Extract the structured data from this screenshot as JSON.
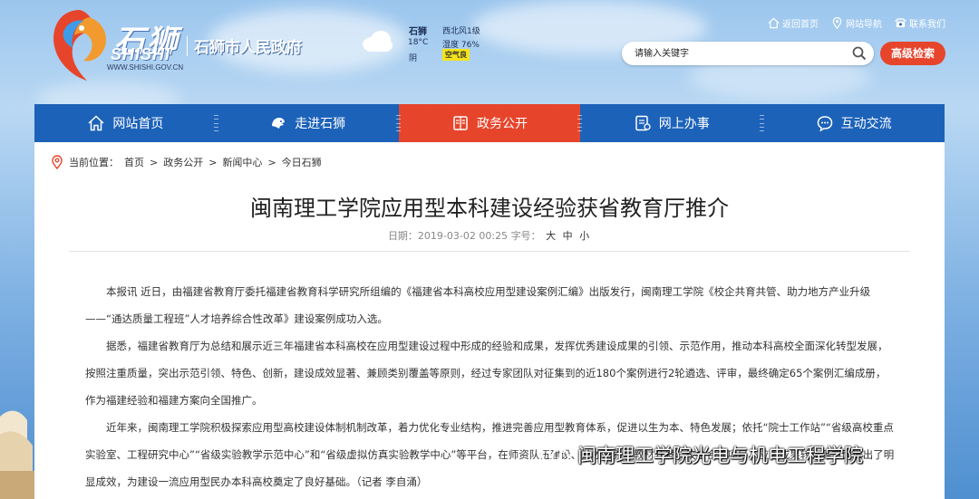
{
  "header": {
    "brand_cn": "石狮",
    "brand_en": "SHISHI",
    "brand_url": "WWW.SHISHI.GOV.CN",
    "gov_name": "石狮市人民政府",
    "weather": {
      "city": "石狮",
      "temperature": "18°C",
      "condition": "阴",
      "wind": "西北风1级",
      "humidity": "湿度 76%",
      "air": "空气良",
      "icon": "cloud-icon"
    },
    "toplinks": [
      {
        "label": "返回首页",
        "icon": "home-icon"
      },
      {
        "label": "网站导航",
        "icon": "location-icon"
      },
      {
        "label": "联系我们",
        "icon": "phone-icon"
      }
    ],
    "search": {
      "placeholder": "请输入关键字"
    },
    "advanced_search": "高级检索"
  },
  "nav": [
    {
      "label": "网站首页",
      "icon": "home-icon",
      "active": false
    },
    {
      "label": "走进石狮",
      "icon": "lion-icon",
      "active": false
    },
    {
      "label": "政务公开",
      "icon": "document-icon",
      "active": true
    },
    {
      "label": "网上办事",
      "icon": "service-icon",
      "active": false
    },
    {
      "label": "互动交流",
      "icon": "chat-icon",
      "active": false
    }
  ],
  "breadcrumb": {
    "prefix": "当前位置：",
    "items": [
      "首页",
      "政务公开",
      "新闻中心",
      "今日石狮"
    ],
    "separator": ">"
  },
  "article": {
    "title": "闽南理工学院应用型本科建设经验获省教育厅推介",
    "date_label": "日期：2019-03-02 00:25",
    "font_label": "字号：",
    "font_sizes": [
      "大",
      "中",
      "小"
    ],
    "paragraphs": [
      "本报讯 近日，由福建省教育厅委托福建省教育科学研究所组编的《福建省本科高校应用型建设案例汇编》出版发行，闽南理工学院《校企共育共管、助力地方产业升级——“通达质量工程班”人才培养综合性改革》建设案例成功入选。",
      "据悉，福建省教育厅为总结和展示近三年福建省本科高校在应用型建设过程中形成的经验和成果，发挥优秀建设成果的引领、示范作用，推动本科高校全面深化转型发展，按照注重质量，突出示范引领、特色、创新，建设成效显著、兼顾类别覆盖等原则，经过专家团队对征集到的近180个案例进行2轮遴选、评审，最终确定65个案例汇编成册，作为福建经验和福建方案向全国推广。",
      "近年来，闽南理工学院积极探索应用型高校建设体制机制改革，着力优化专业结构，推进完善应用型教育体系，促进以生为本、特色发展；依托“院士工作站”“省级高校重点实验室、工程研究中心”“省级实验教学示范中心”和“省级虚拟仿真实验教学中心”等平台，在师资队伍建设、人才培养、教材开发、校企合作项目、应用成果转化等方面做出了明显成效，为建设一流应用型民办本科高校奠定了良好基础。（记者 李自涌）"
    ]
  },
  "watermark": "闽南理工学院光电与机电工程学院",
  "colors": {
    "nav_blue": "#1c62b9",
    "active_red": "#e6452c",
    "air_yellow": "#f5e31a"
  }
}
